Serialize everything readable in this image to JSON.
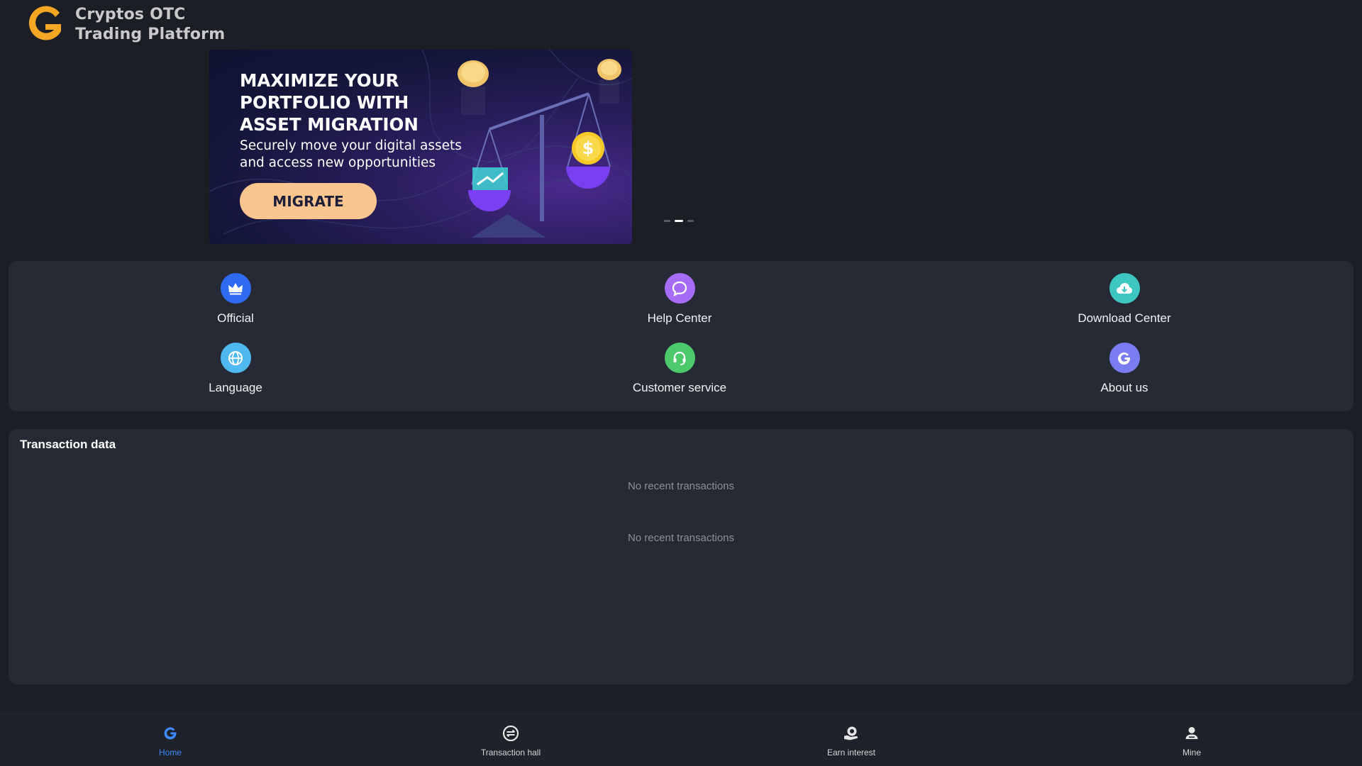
{
  "header": {
    "brand_line1": "Cryptos  OTC",
    "brand_line2": "Trading  Platform",
    "logo_icon": "g-logo-icon",
    "logo_color": "#f5a623"
  },
  "banner": {
    "title_line1": "MAXIMIZE YOUR",
    "title_line2": "PORTFOLIO WITH",
    "title_line3": "ASSET MIGRATION",
    "subtitle_line1": "Securely move your digital assets",
    "subtitle_line2": "and access new opportunities",
    "button_label": "MIGRATE",
    "coin_symbol": "$",
    "carousel_active_index": 1,
    "carousel_count": 3
  },
  "menu": {
    "items": [
      {
        "label": "Official",
        "icon": "crown-icon",
        "color": "#2f6bf0"
      },
      {
        "label": "Help Center",
        "icon": "chat-bubble-icon",
        "color": "#a66cf5"
      },
      {
        "label": "Download Center",
        "icon": "cloud-download-icon",
        "color": "#3ec7c0"
      },
      {
        "label": "Language",
        "icon": "globe-icon",
        "color": "#4fb8f0"
      },
      {
        "label": "Customer service",
        "icon": "headset-icon",
        "color": "#4cc96a"
      },
      {
        "label": "About us",
        "icon": "g-logo-icon",
        "color": "#7a7df2"
      }
    ]
  },
  "transactions": {
    "title": "Transaction data",
    "empty_1": "No recent transactions",
    "empty_2": "No recent transactions"
  },
  "nav": {
    "active_color": "#3d8bff",
    "items": [
      {
        "label": "Home",
        "icon": "home-g-icon",
        "active": true
      },
      {
        "label": "Transaction hall",
        "icon": "exchange-icon",
        "active": false
      },
      {
        "label": "Earn interest",
        "icon": "interest-icon",
        "active": false
      },
      {
        "label": "Mine",
        "icon": "user-icon",
        "active": false
      }
    ]
  }
}
